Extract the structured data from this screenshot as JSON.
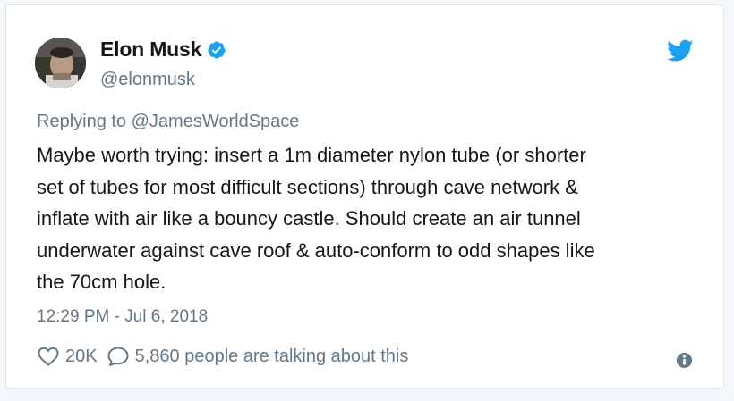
{
  "tweet": {
    "author": {
      "name": "Elon Musk",
      "handle": "@elonmusk",
      "verified_icon": "verified-badge-icon",
      "avatar": "profile-photo"
    },
    "platform_icon": "twitter-bird-icon",
    "reply_prefix": "Replying to",
    "reply_to": "@JamesWorldSpace",
    "body_lines": [
      "Maybe worth trying: insert a 1m diameter nylon tube (or shorter",
      "set of tubes for most difficult sections) through cave network &",
      "inflate with air like a bouncy castle. Should create an air tunnel",
      "underwater against cave roof & auto-conform to odd shapes like",
      "the 70cm hole."
    ],
    "timestamp": "12:29 PM - Jul 6, 2018",
    "likes": "20K",
    "talking": "5,860 people are talking about this",
    "info_icon": "info-icon"
  },
  "colors": {
    "twitter_blue": "#1da1f2",
    "text": "#14171a",
    "secondary": "#657786",
    "border": "#dfe3e6",
    "background": "#f5f8fa"
  }
}
